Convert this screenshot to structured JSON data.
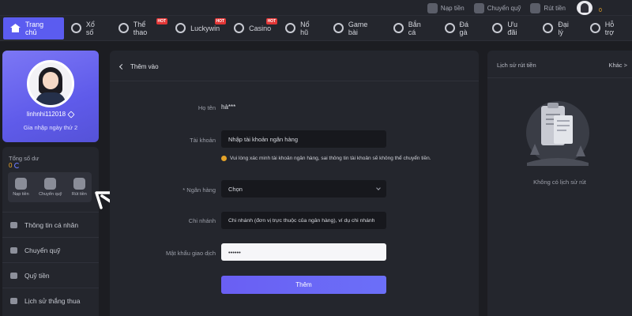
{
  "topbar": {
    "actions": [
      {
        "label": "Nạp tiền",
        "icon": "deposit-icon"
      },
      {
        "label": "Chuyển quỹ",
        "icon": "transfer-icon"
      },
      {
        "label": "Rút tiền",
        "icon": "withdraw-icon"
      }
    ],
    "balance": "0"
  },
  "nav": [
    {
      "label": "Trang chủ",
      "active": true
    },
    {
      "label": "Xổ số"
    },
    {
      "label": "Thể thao",
      "badge": "HOT"
    },
    {
      "label": "Luckywin",
      "badge": "HOT"
    },
    {
      "label": "Casino",
      "badge": "HOT"
    },
    {
      "label": "Nổ hũ"
    },
    {
      "label": "Game bài"
    },
    {
      "label": "Bắn cá"
    },
    {
      "label": "Đá gà"
    },
    {
      "label": "Ưu đãi"
    },
    {
      "label": "Đại lý"
    },
    {
      "label": "Hỗ trợ"
    }
  ],
  "profile": {
    "username": "linhnhi112018",
    "joined": "Gia nhập ngày thứ 2"
  },
  "balance": {
    "label": "Tổng số dư",
    "value": "0"
  },
  "quick_actions": [
    {
      "label": "Nạp tiền"
    },
    {
      "label": "Chuyển quỹ"
    },
    {
      "label": "Rút tiền"
    }
  ],
  "menu": [
    {
      "label": "Thông tin cá nhân"
    },
    {
      "label": "Chuyển quỹ"
    },
    {
      "label": "Quỹ tiền"
    },
    {
      "label": "Lịch sử thắng thua"
    }
  ],
  "form": {
    "back_label": "Thêm vào",
    "name_label": "Họ tên",
    "name_value": "hà***",
    "account_label": "Tài khoản",
    "account_placeholder": "Nhập tài khoản ngân hàng",
    "warning": "Vui lòng xác minh tài khoản ngân hàng, sai thông tin tài khoản sẽ không thể chuyển tiền.",
    "bank_label": "* Ngân hàng",
    "bank_value": "Chọn",
    "branch_label": "Chi nhánh",
    "branch_placeholder": "Chi nhánh (đơn vị trực thuộc của ngân hàng), ví dụ chi nhánh",
    "pin_label": "Mật khẩu giao dịch",
    "pin_value": "••••••",
    "submit_label": "Thêm"
  },
  "history": {
    "title": "Lịch sử rút tiền",
    "more": "Khác >",
    "empty": "Không có lịch sử rút"
  },
  "colors": {
    "accent": "#5b5cf0",
    "balance": "#f0a928",
    "background": "#1c1d22",
    "panel": "#24262d"
  }
}
